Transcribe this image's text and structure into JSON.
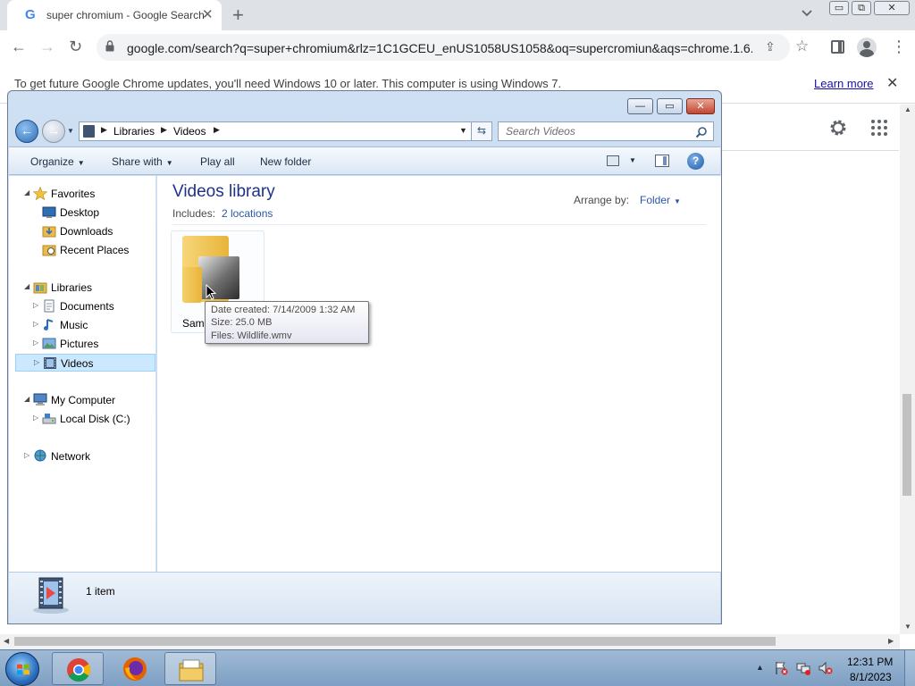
{
  "browser": {
    "tab": {
      "title": "super chromium - Google Search",
      "favicon": "G"
    },
    "newtab_label": "+",
    "window_buttons": {
      "minimize": "▭",
      "maximize": "⧉",
      "close": "✕"
    },
    "url": "google.com/search?q=super+chromium&rlz=1C1GCEU_enUS1058US1058&oq=supercromiun&aqs=chrome.1.6...",
    "infobar": {
      "message": "To get future Google Chrome updates, you'll need Windows 10 or later. This computer is using Windows 7.",
      "learn_more": "Learn more",
      "close": "✕"
    }
  },
  "explorer": {
    "caption_buttons": {
      "minimize": "—",
      "maximize": "▭",
      "close": "✕"
    },
    "address": {
      "crumbs": [
        "Libraries",
        "Videos"
      ]
    },
    "search": {
      "placeholder": "Search Videos"
    },
    "commands": {
      "organize": "Organize",
      "share_with": "Share with",
      "play_all": "Play all",
      "new_folder": "New folder",
      "help": "?"
    },
    "nav": {
      "favorites": "Favorites",
      "desktop": "Desktop",
      "downloads": "Downloads",
      "recent_places": "Recent Places",
      "libraries": "Libraries",
      "documents": "Documents",
      "music": "Music",
      "pictures": "Pictures",
      "videos": "Videos",
      "my_computer": "My Computer",
      "local_disk": "Local Disk (C:)",
      "network": "Network"
    },
    "content": {
      "title": "Videos library",
      "includes_label": "Includes:",
      "locations_link": "2 locations",
      "arrange_by_label": "Arrange by:",
      "arrange_by_value": "Folder",
      "folder_label": "Samp"
    },
    "tooltip": {
      "date_created": "Date created: 7/14/2009 1:32 AM",
      "size": "Size: 25.0 MB",
      "files": "Files: Wildlife.wmv"
    },
    "details": {
      "count": "1 item"
    }
  },
  "taskbar": {
    "clock_time": "12:31 PM",
    "clock_date": "8/1/2023"
  },
  "colors": {
    "chrome_tabstrip": "#dee1e6",
    "explorer_frame": "#bcd3ec",
    "library_title": "#1e3287",
    "link_blue": "#2a57a8",
    "taskbar": "#7e9fc3"
  }
}
